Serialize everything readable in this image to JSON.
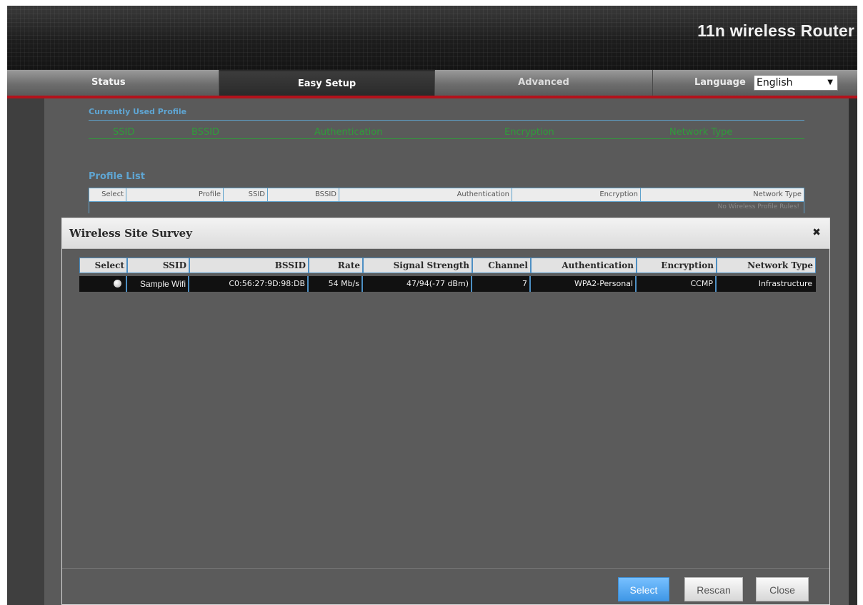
{
  "header": {
    "brand": "11n wireless Router"
  },
  "nav": {
    "tabs": [
      {
        "label": "Status"
      },
      {
        "label": "Easy Setup",
        "active": true
      },
      {
        "label": "Advanced"
      }
    ],
    "language_label": "Language",
    "language_value": "English"
  },
  "current_profile": {
    "title": "Currently Used Profile",
    "fields": [
      "SSID",
      "BSSID",
      "Authentication",
      "Encryption",
      "Network Type"
    ]
  },
  "profile_list": {
    "title": "Profile List",
    "columns": [
      "Select",
      "Profile",
      "SSID",
      "BSSID",
      "Authentication",
      "Encryption",
      "Network Type"
    ],
    "empty_text": "No Wireless Profile Rules!"
  },
  "site_survey": {
    "title": "Wireless Site Survey",
    "columns": [
      "Select",
      "SSID",
      "BSSID",
      "Rate",
      "Signal Strength",
      "Channel",
      "Authentication",
      "Encryption",
      "Network Type"
    ],
    "rows": [
      {
        "ssid": "Sample Wifi",
        "bssid": "C0:56:27:9D:98:DB",
        "rate": "54 Mb/s",
        "signal": "47/94(-77 dBm)",
        "channel": "7",
        "authentication": "WPA2-Personal",
        "encryption": "CCMP",
        "network_type": "Infrastructure"
      }
    ],
    "buttons": {
      "select": "Select",
      "rescan": "Rescan",
      "close": "Close"
    }
  }
}
